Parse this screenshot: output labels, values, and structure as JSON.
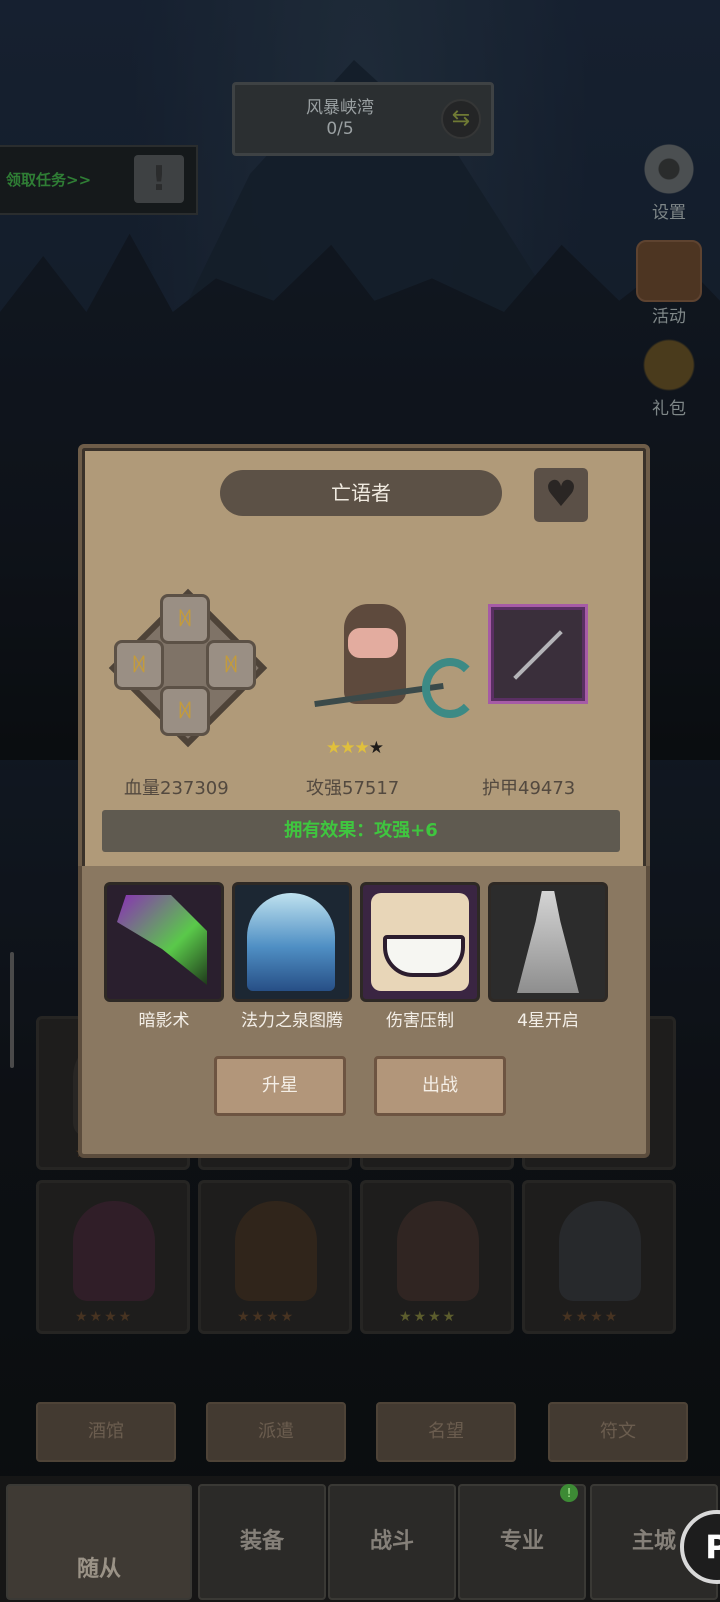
{
  "zone": {
    "name": "风暴峡湾",
    "progress": "0/5"
  },
  "task": {
    "label": "领取任务>>",
    "icon": "exclamation-icon"
  },
  "side": {
    "settings": "设置",
    "activity": "活动",
    "gift": "礼包"
  },
  "hero": {
    "name": "亡语者",
    "stars_filled": 3,
    "stars_total": 4,
    "stars_on": "★★★",
    "stars_off": "★",
    "hp": "血量237309",
    "attack": "攻强57517",
    "armor": "护甲49473",
    "effect": "拥有效果：攻强+6",
    "rune_glyph": "ᛞ"
  },
  "skills": [
    {
      "label": "暗影术",
      "icon": "shadow-arrow-icon"
    },
    {
      "label": "法力之泉图腾",
      "icon": "mana-totem-icon"
    },
    {
      "label": "伤害压制",
      "icon": "grin-mask-icon"
    },
    {
      "label": "4星开启",
      "icon": "locked-skill-icon"
    }
  ],
  "buttons": {
    "upgrade": "升星",
    "deploy": "出战"
  },
  "grid_stars": "★★★★",
  "category_tabs": [
    "酒馆",
    "派遣",
    "名望",
    "符文"
  ],
  "bottom_nav": [
    "随从",
    "装备",
    "战斗",
    "专业",
    "主城"
  ],
  "badge": "!",
  "fab": "P",
  "colors": {
    "panel": "#b09a79",
    "effect_text": "#3fc63f",
    "star": "#e0c03c"
  }
}
